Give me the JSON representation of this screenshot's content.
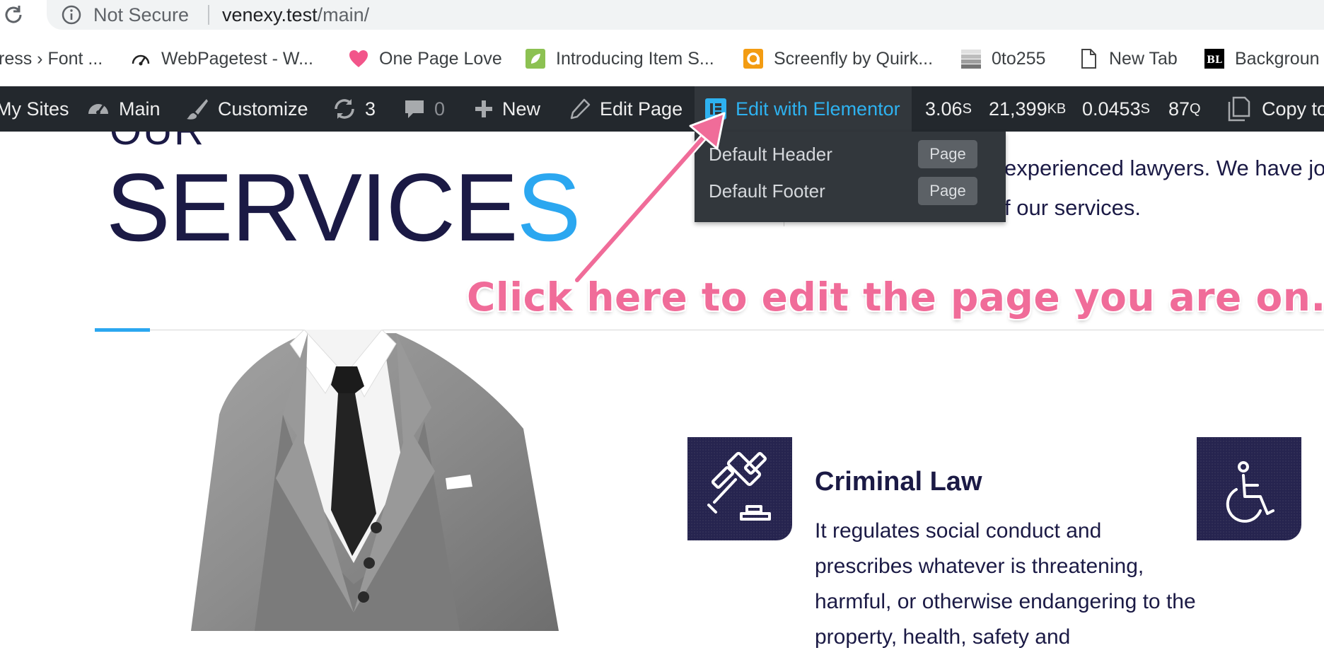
{
  "browser": {
    "security_label": "Not Secure",
    "url_host": "venexy.test",
    "url_path": "/main/"
  },
  "bookmarks": [
    {
      "label": "ress › Font ...",
      "icon": "none"
    },
    {
      "label": "WebPagetest - W...",
      "icon": "speedometer-icon"
    },
    {
      "label": "One Page Love",
      "icon": "heart-icon"
    },
    {
      "label": "Introducing Item S...",
      "icon": "leaf-icon"
    },
    {
      "label": "Screenfly by Quirk...",
      "icon": "screenfly-icon"
    },
    {
      "label": "0to255",
      "icon": "gradient-icon"
    },
    {
      "label": "New Tab",
      "icon": "page-icon"
    },
    {
      "label": "Backgroun",
      "icon": "bl-icon"
    }
  ],
  "adminbar": {
    "my_sites": "My Sites",
    "main": "Main",
    "customize": "Customize",
    "updates_count": "3",
    "comments_count": "0",
    "new": "New",
    "edit_page": "Edit Page",
    "edit_elementor": "Edit with Elementor",
    "metrics": {
      "time": "3.06",
      "time_unit": "S",
      "memory": "21,399",
      "memory_unit": "KB",
      "query_time": "0.0453",
      "query_time_unit": "S",
      "queries": "87",
      "queries_unit": "Q"
    },
    "copy": "Copy to",
    "elementor_color": "#2eb2f0"
  },
  "elementor_menu": [
    {
      "label": "Default Header",
      "badge": "Page"
    },
    {
      "label": "Default Footer",
      "badge": "Page"
    }
  ],
  "content": {
    "heading_small": "OUR",
    "heading_main": "SERVICE",
    "heading_accent": "S",
    "intro_line1": "experienced lawyers. We have jo",
    "intro_line2": "f our services.",
    "accent_color": "#2ba7f0",
    "service": {
      "title": "Criminal Law",
      "description": "It regulates social conduct and prescribes whatever is threatening, harmful, or otherwise endangering to the property, health, safety and"
    }
  },
  "annotation": {
    "text": "Click here to edit the page you are on.",
    "color": "#f06c99"
  }
}
